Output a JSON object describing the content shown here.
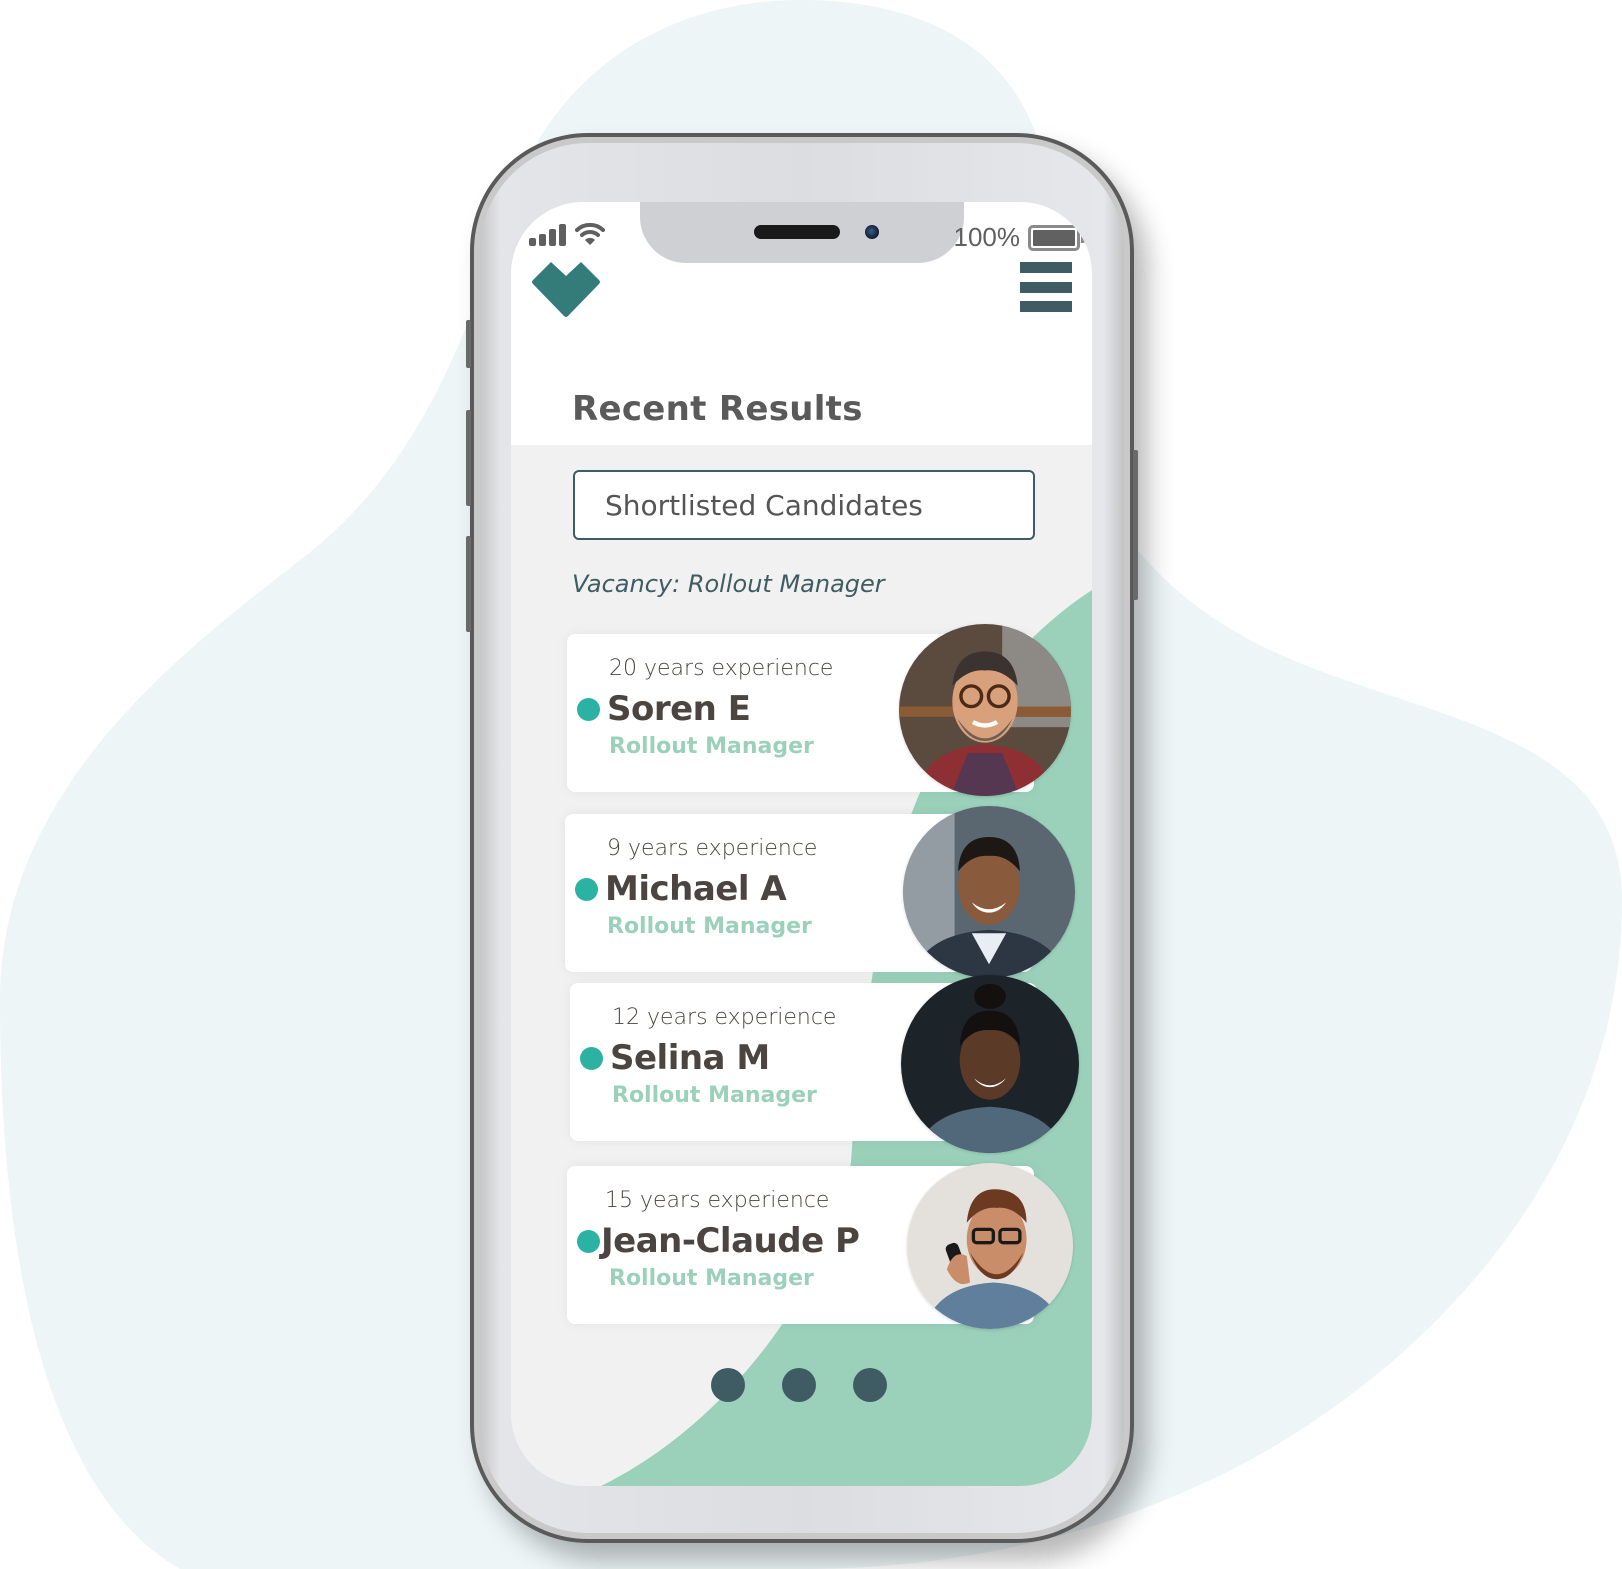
{
  "status_bar": {
    "signal_icon": "signal-bars-icon",
    "wifi_icon": "wifi-icon",
    "battery_percent_label": "100%",
    "battery_level": 1.0,
    "battery_icon": "battery-icon"
  },
  "header": {
    "logo_icon": "heart-diamond-logo",
    "menu_icon": "hamburger-menu-icon"
  },
  "main": {
    "title": "Recent Results",
    "filter_select": {
      "value": "Shortlisted Candidates"
    },
    "vacancy_label": "Vacancy: Rollout Manager"
  },
  "candidates": [
    {
      "experience": "20 years experience",
      "name": "Soren E",
      "role": "Rollout Manager",
      "status": "active"
    },
    {
      "experience": "9 years experience",
      "name": "Michael A",
      "role": "Rollout Manager",
      "status": "active"
    },
    {
      "experience": "12 years experience",
      "name": "Selina M",
      "role": "Rollout Manager",
      "status": "active"
    },
    {
      "experience": "15 years experience",
      "name": "Jean-Claude P",
      "role": "Rollout Manager",
      "status": "active"
    }
  ],
  "pagination": {
    "pages": 3
  },
  "colors": {
    "brand_teal": "#347c7a",
    "dark_slate": "#3f5b64",
    "mint_green": "#9bd1bb",
    "status_dot": "#2bb2a2",
    "name_text": "#4b4440",
    "background_blob": "#edf5f6"
  }
}
